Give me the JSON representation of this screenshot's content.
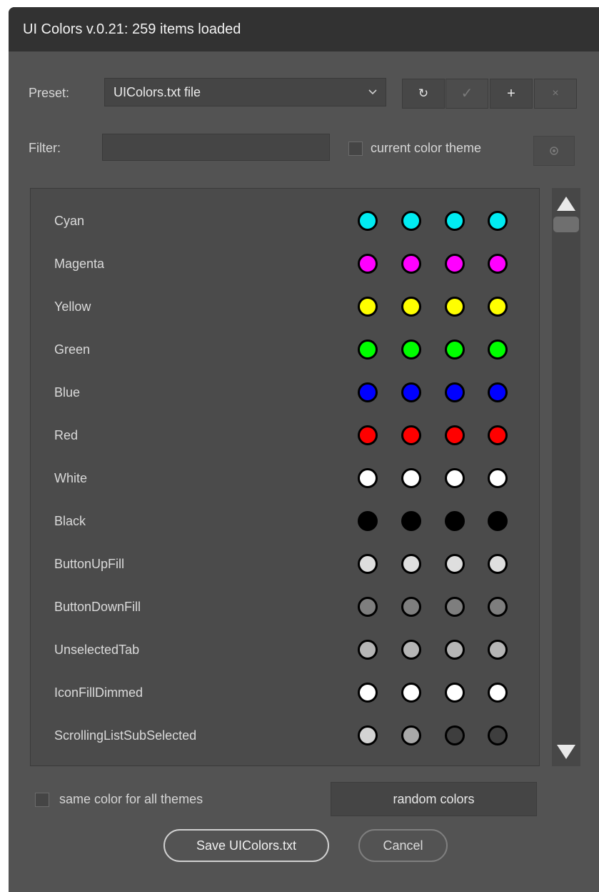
{
  "window": {
    "title": "UI Colors v.0.21: 259 items loaded"
  },
  "preset": {
    "label": "Preset:",
    "value": "UIColors.txt file",
    "buttons": {
      "reload": "↻",
      "apply": "✓",
      "add": "+",
      "remove": "×"
    }
  },
  "filter": {
    "label": "Filter:",
    "value": "",
    "theme_checkbox_label": "current color theme",
    "theme_checkbox_checked": false
  },
  "colors": {
    "black": "#000000",
    "dark": "#3e3e3e",
    "gray": "#7e7e7e",
    "silver": "#b5b5b5",
    "light": "#d3d3d3",
    "lighter": "#dedede",
    "white": "#ffffff"
  },
  "items": [
    {
      "name": "Cyan",
      "swatches": [
        "#00ecf2",
        "#00ecf2",
        "#00ecf2",
        "#00ecf2"
      ]
    },
    {
      "name": "Magenta",
      "swatches": [
        "#ff00ff",
        "#ff00ff",
        "#ff00ff",
        "#ff00ff"
      ]
    },
    {
      "name": "Yellow",
      "swatches": [
        "#ffff00",
        "#ffff00",
        "#ffff00",
        "#ffff00"
      ]
    },
    {
      "name": "Green",
      "swatches": [
        "#00ff00",
        "#00ff00",
        "#00ff00",
        "#00ff00"
      ]
    },
    {
      "name": "Blue",
      "swatches": [
        "#0000ff",
        "#0000ff",
        "#0000ff",
        "#0000ff"
      ]
    },
    {
      "name": "Red",
      "swatches": [
        "#ff0000",
        "#ff0000",
        "#ff0000",
        "#ff0000"
      ]
    },
    {
      "name": "White",
      "swatches": [
        "#ffffff",
        "#ffffff",
        "#ffffff",
        "#ffffff"
      ]
    },
    {
      "name": "Black",
      "swatches": [
        "#000000",
        "#000000",
        "#000000",
        "#000000"
      ]
    },
    {
      "name": "ButtonUpFill",
      "swatches": [
        "#dedede",
        "#dedede",
        "#dedede",
        "#dedede"
      ]
    },
    {
      "name": "ButtonDownFill",
      "swatches": [
        "#7e7e7e",
        "#7e7e7e",
        "#7e7e7e",
        "#7e7e7e"
      ]
    },
    {
      "name": "UnselectedTab",
      "swatches": [
        "#b5b5b5",
        "#b5b5b5",
        "#b5b5b5",
        "#b5b5b5"
      ]
    },
    {
      "name": "IconFillDimmed",
      "swatches": [
        "#ffffff",
        "#ffffff",
        "#ffffff",
        "#ffffff"
      ]
    },
    {
      "name": "ScrollingListSubSelected",
      "swatches": [
        "#d3d3d3",
        "#a8a8a8",
        "#3e3e3e",
        "#3e3e3e"
      ]
    }
  ],
  "options": {
    "same_color_label": "same color for all themes",
    "same_color_checked": false,
    "random_label": "random colors"
  },
  "footer": {
    "save_label": "Save UIColors.txt",
    "cancel_label": "Cancel"
  }
}
